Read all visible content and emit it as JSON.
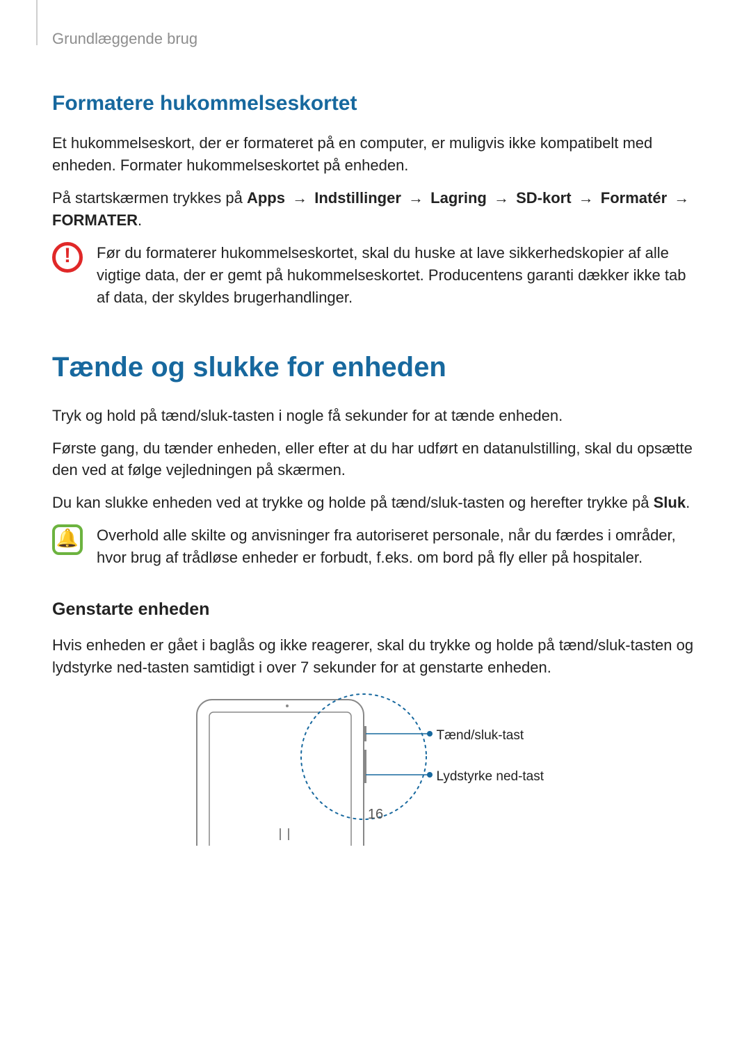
{
  "header": "Grundlæggende brug",
  "section1": {
    "title": "Formatere hukommelseskortet",
    "p1": "Et hukommelseskort, der er formateret på en computer, er muligvis ikke kompatibelt med enheden. Formater hukommelseskortet på enheden.",
    "p2_lead": "På startskærmen trykkes på ",
    "p2_path": [
      "Apps",
      "Indstillinger",
      "Lagring",
      "SD-kort",
      "Formatér"
    ],
    "p2_last": "FORMATER",
    "warn": "Før du formaterer hukommelseskortet, skal du huske at lave sikkerhedskopier af alle vigtige data, der er gemt på hukommelseskortet. Producentens garanti dækker ikke tab af data, der skyldes brugerhandlinger."
  },
  "section2": {
    "title": "Tænde og slukke for enheden",
    "p1": "Tryk og hold på tænd/sluk-tasten i nogle få sekunder for at tænde enheden.",
    "p2": "Første gang, du tænder enheden, eller efter at du har udført en datanulstilling, skal du opsætte den ved at følge vejledningen på skærmen.",
    "p3_a": "Du kan slukke enheden ved at trykke og holde på tænd/sluk-tasten og herefter trykke på ",
    "p3_b": "Sluk",
    "p3_c": ".",
    "bell": "Overhold alle skilte og anvisninger fra autoriseret personale, når du færdes i områder, hvor brug af trådløse enheder er forbudt, f.eks. om bord på fly eller på hospitaler.",
    "sub": {
      "title": "Genstarte enheden",
      "p1": "Hvis enheden er gået i baglås og ikke reagerer, skal du trykke og holde på tænd/sluk-tasten og lydstyrke ned-tasten samtidigt i over 7 sekunder for at genstarte enheden."
    }
  },
  "diagram": {
    "label_power": "Tænd/sluk-tast",
    "label_voldown": "Lydstyrke ned-tast"
  },
  "page_number": "16",
  "arrow": "→"
}
